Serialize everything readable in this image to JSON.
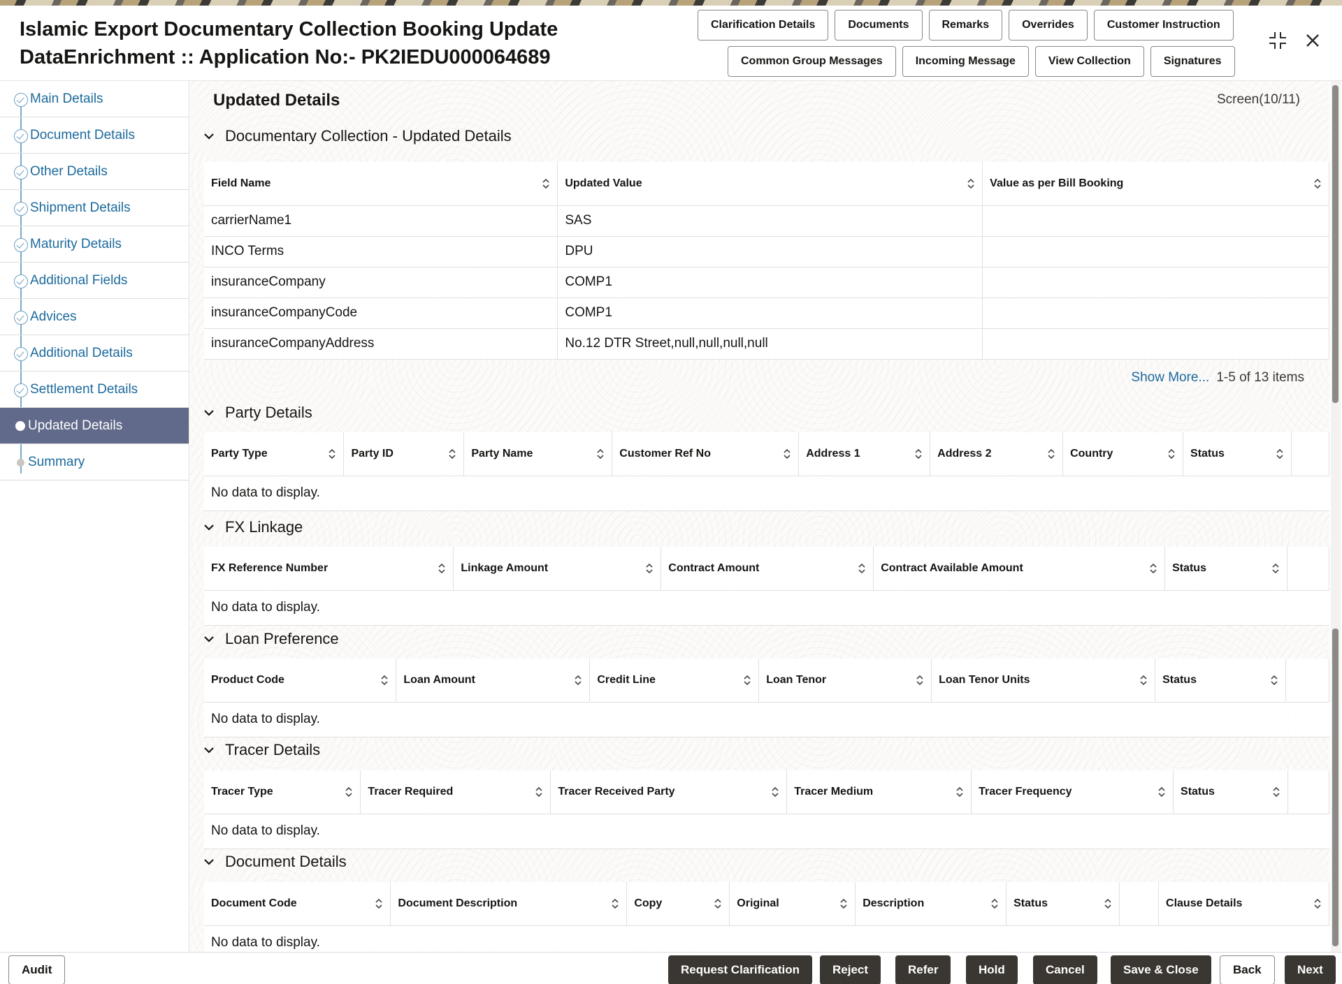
{
  "header": {
    "title_line1": "Islamic Export Documentary Collection Booking Update",
    "title_line2": "DataEnrichment :: Application No:- PK2IEDU000064689",
    "buttons_row1": [
      "Clarification Details",
      "Documents",
      "Remarks",
      "Overrides",
      "Customer Instruction"
    ],
    "buttons_row2": [
      "Common Group Messages",
      "Incoming Message",
      "View Collection",
      "Signatures"
    ],
    "icons": [
      "collapse-icon",
      "close-icon"
    ]
  },
  "sidebar": {
    "items": [
      {
        "label": "Main Details",
        "state": "done"
      },
      {
        "label": "Document Details",
        "state": "done"
      },
      {
        "label": "Other Details",
        "state": "done"
      },
      {
        "label": "Shipment Details",
        "state": "done"
      },
      {
        "label": "Maturity Details",
        "state": "done"
      },
      {
        "label": "Additional Fields",
        "state": "done"
      },
      {
        "label": "Advices",
        "state": "done"
      },
      {
        "label": "Additional Details",
        "state": "done"
      },
      {
        "label": "Settlement Details",
        "state": "done"
      },
      {
        "label": "Updated Details",
        "state": "active"
      },
      {
        "label": "Summary",
        "state": "pending"
      }
    ]
  },
  "main": {
    "heading": "Updated Details",
    "screen_count": "Screen(10/11)",
    "updated": {
      "title": "Documentary Collection - Updated Details",
      "columns": [
        "Field Name",
        "Updated Value",
        "Value as per Bill Booking"
      ],
      "rows": [
        [
          "carrierName1",
          "SAS",
          ""
        ],
        [
          "INCO Terms",
          "DPU",
          ""
        ],
        [
          "insuranceCompany",
          "COMP1",
          ""
        ],
        [
          "insuranceCompanyCode",
          "COMP1",
          ""
        ],
        [
          "insuranceCompanyAddress",
          "No.12 DTR Street,null,null,null,null",
          ""
        ]
      ],
      "show_more": "Show More...",
      "pager": "1-5 of 13 items"
    },
    "party": {
      "title": "Party Details",
      "columns": [
        "Party Type",
        "Party ID",
        "Party Name",
        "Customer Ref No",
        "Address 1",
        "Address 2",
        "Country",
        "Status"
      ],
      "empty": "No data to display."
    },
    "fx": {
      "title": "FX Linkage",
      "columns": [
        "FX Reference Number",
        "Linkage Amount",
        "Contract Amount",
        "Contract Available Amount",
        "Status"
      ],
      "empty": "No data to display."
    },
    "loan": {
      "title": "Loan Preference",
      "columns": [
        "Product Code",
        "Loan Amount",
        "Credit Line",
        "Loan Tenor",
        "Loan Tenor Units",
        "Status"
      ],
      "empty": "No data to display."
    },
    "tracer": {
      "title": "Tracer Details",
      "columns": [
        "Tracer Type",
        "Tracer Required",
        "Tracer Received Party",
        "Tracer Medium",
        "Tracer Frequency",
        "Status"
      ],
      "empty": "No data to display."
    },
    "document": {
      "title": "Document Details",
      "columns": [
        "Document Code",
        "Document Description",
        "Copy",
        "Original",
        "Description",
        "Status",
        "",
        "Clause Details"
      ],
      "empty": "No data to display."
    }
  },
  "footer": {
    "audit": "Audit",
    "request_clarification": "Request Clarification",
    "reject": "Reject",
    "refer": "Refer",
    "hold": "Hold",
    "cancel": "Cancel",
    "save_close": "Save & Close",
    "back": "Back",
    "next": "Next"
  },
  "colors": {
    "accent_link": "#1c6a9c",
    "active_nav": "#616a8a",
    "dark_button": "#3a3631"
  }
}
